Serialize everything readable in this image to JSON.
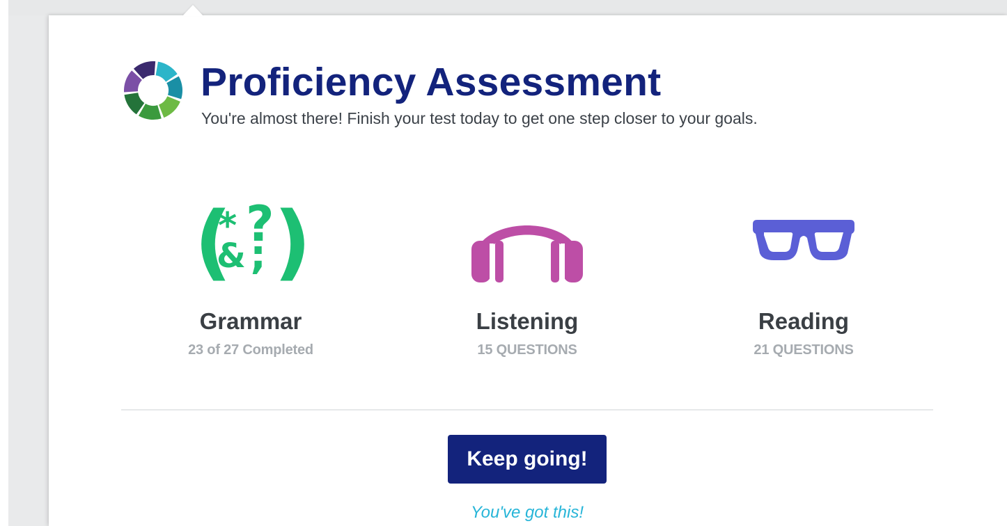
{
  "header": {
    "title": "Proficiency Assessment",
    "subtitle": "You're almost there! Finish your test today to get one step closer to your goals.",
    "logo_icon": "segmented-ring-logo-icon"
  },
  "sections": [
    {
      "label": "Grammar",
      "meta": "23 of 27 Completed",
      "icon": "grammar-symbols-icon",
      "color": "#1dbf73",
      "completed": 23,
      "total": 27
    },
    {
      "label": "Listening",
      "meta": "15 QUESTIONS",
      "icon": "headphones-icon",
      "color": "#bd4ea6"
    },
    {
      "label": "Reading",
      "meta": "21 QUESTIONS",
      "icon": "glasses-icon",
      "color": "#5b5fd6"
    }
  ],
  "actions": {
    "primary_label": "Keep going!",
    "encouragement": "You've got this!"
  },
  "colors": {
    "brand": "#13237c",
    "accent": "#27b5d8",
    "muted_text": "#a6abb0"
  }
}
